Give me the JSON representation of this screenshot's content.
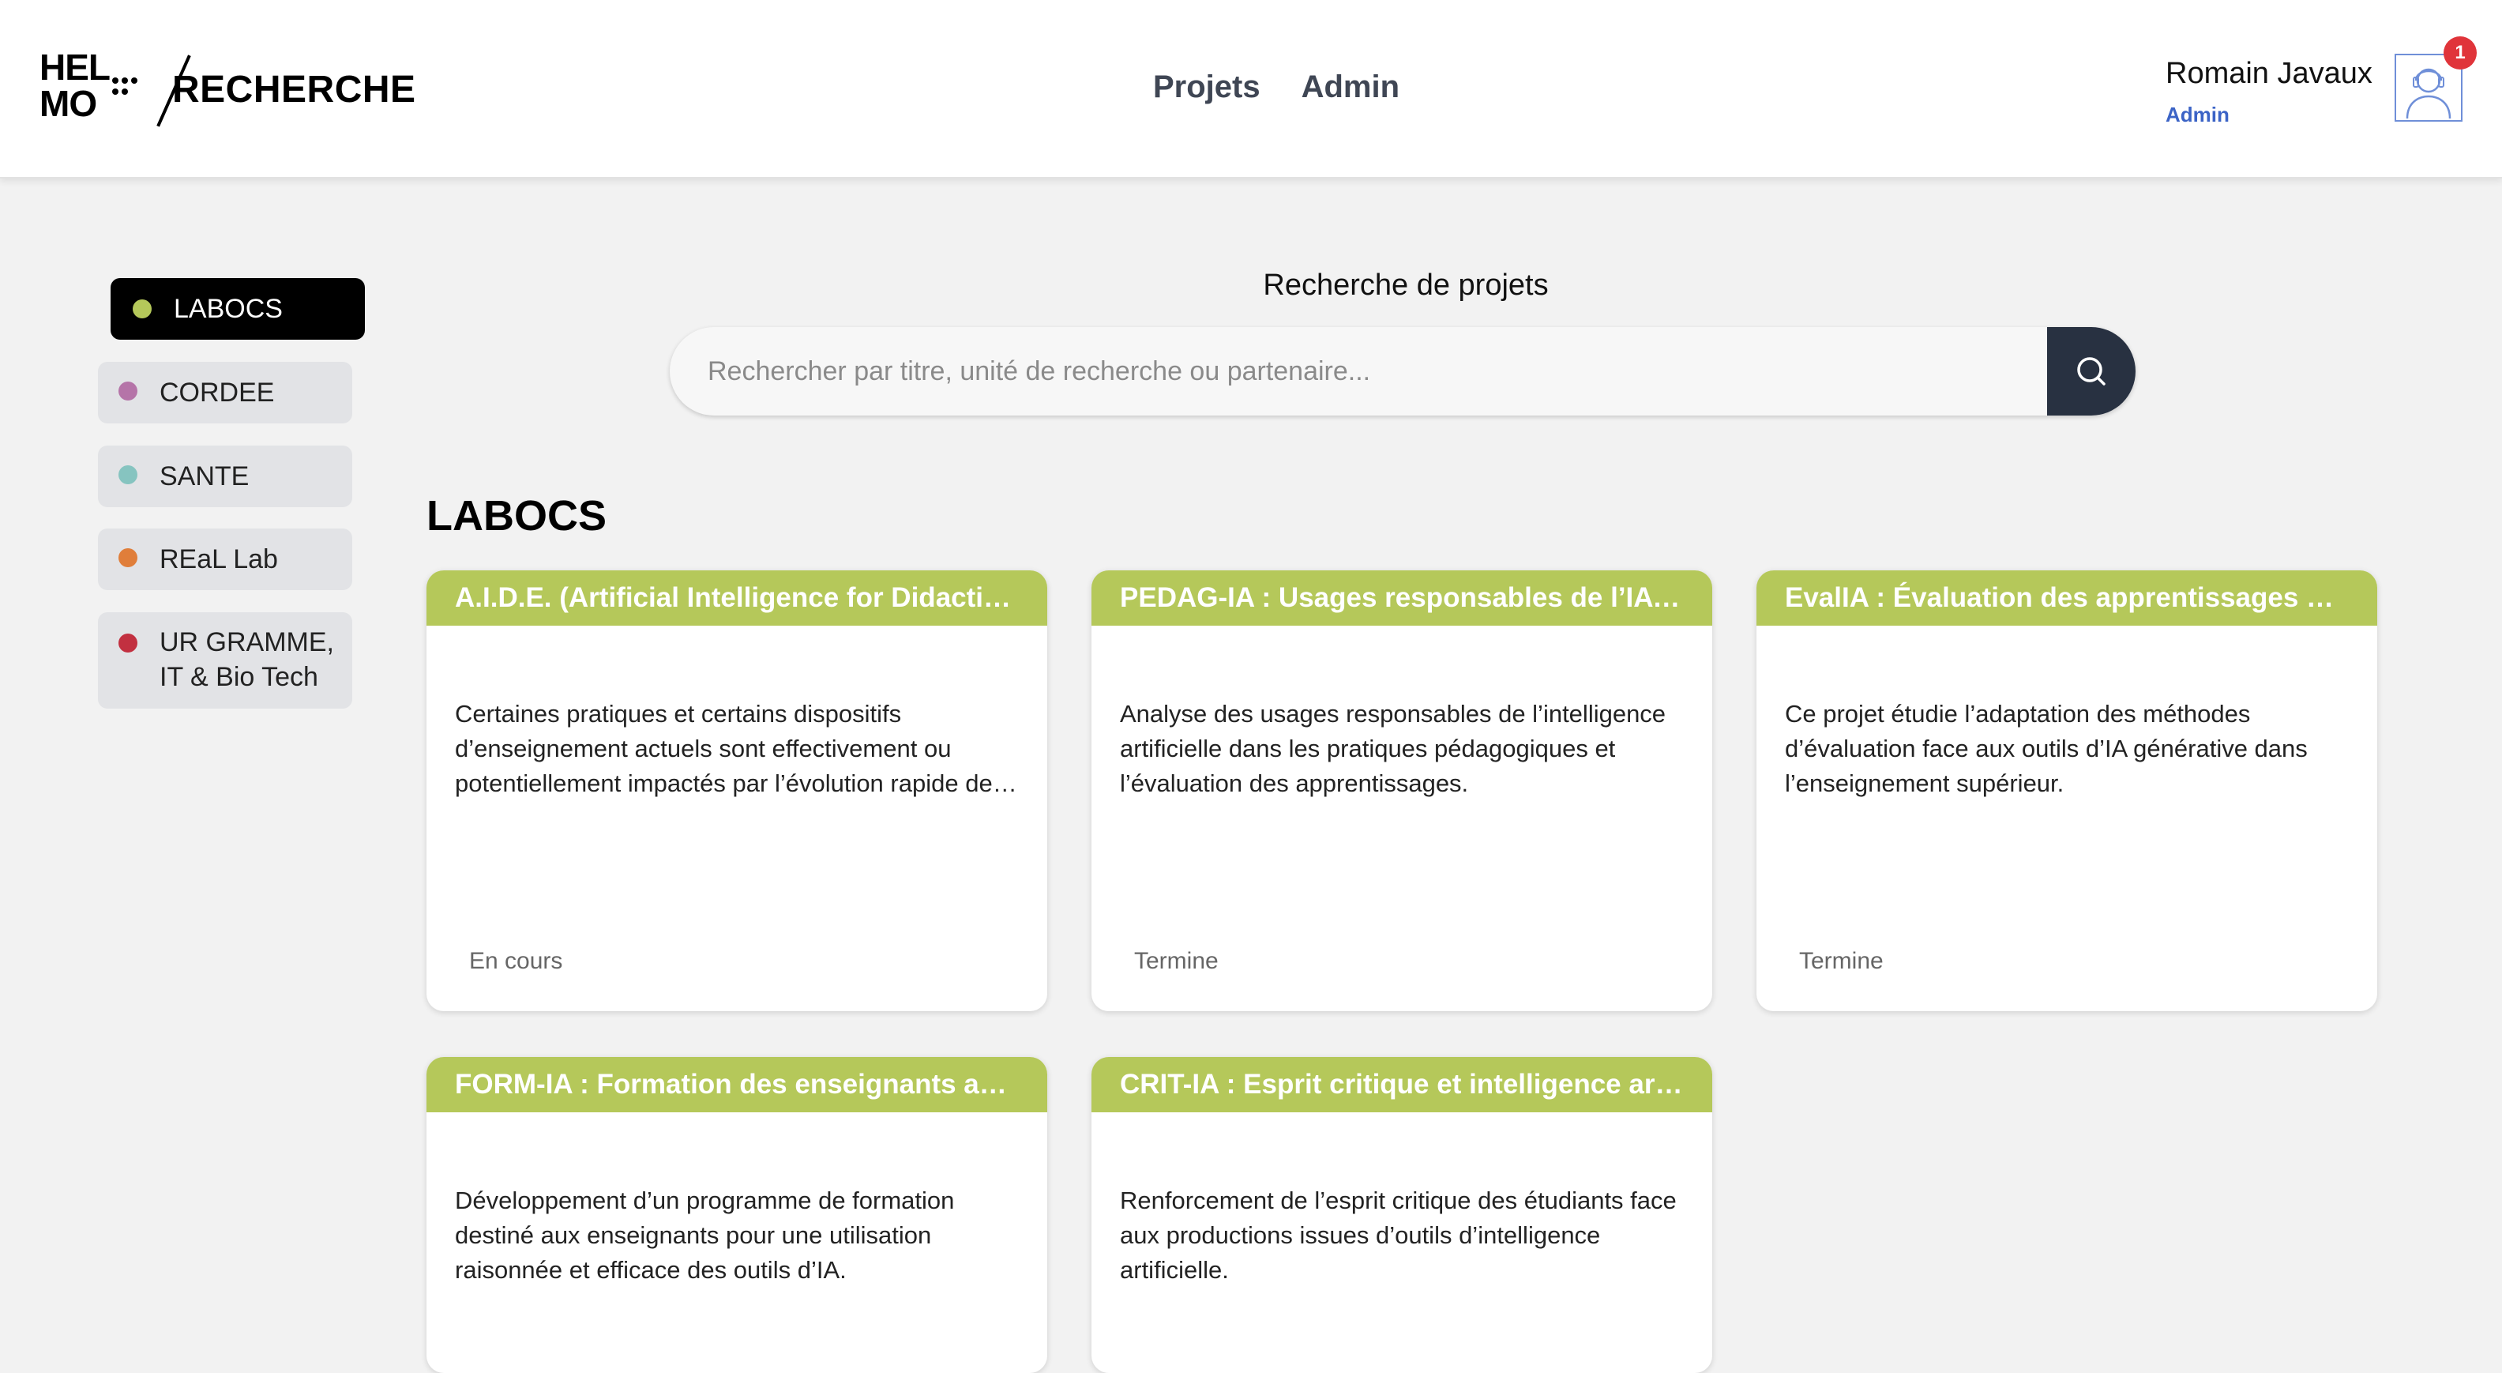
{
  "header": {
    "logo_hel": "HEL",
    "logo_mo": "MO",
    "logo_text": "RECHERCHE",
    "nav": [
      "Projets",
      "Admin"
    ],
    "user_name": "Romain Javaux",
    "user_role": "Admin",
    "notification_count": "1"
  },
  "sidebar": {
    "items": [
      {
        "label": "LABOCS",
        "color": "#b5c85a",
        "active": true
      },
      {
        "label": "CORDEE",
        "color": "#b574a8",
        "active": false
      },
      {
        "label": "SANTE",
        "color": "#86c4c0",
        "active": false
      },
      {
        "label": "REaL Lab",
        "color": "#e07e3a",
        "active": false
      },
      {
        "label_line1": "UR GRAMME,",
        "label_line2": "IT & Bio Tech",
        "color": "#c23040",
        "active": false
      }
    ]
  },
  "search": {
    "title": "Recherche de projets",
    "placeholder": "Rechercher par titre, unité de recherche ou partenaire..."
  },
  "section": {
    "title": "LABOCS",
    "accent": "#b5c85a"
  },
  "cards": [
    {
      "title": "A.I.D.E. (Artificial Intelligence for Didactics and Education)",
      "description": "Certaines pratiques et certains dispositifs d’enseignement actuels sont effectivement ou potentiellement impactés par l’évolution rapide de l’intelligence artificielle.",
      "status": "En cours"
    },
    {
      "title": "PEDAG-IA : Usages responsables de l’IA en pédagogie",
      "description": "Analyse des usages responsables de l’intelligence artificielle dans les pratiques pédagogiques et l’évaluation des apprentissages.",
      "status": "Termine"
    },
    {
      "title": "EvalIA : Évaluation des apprentissages à l’ère de l’IA",
      "description": "Ce projet étudie l’adaptation des méthodes d’évaluation face aux outils d’IA générative dans l’enseignement supérieur.",
      "status": "Termine"
    },
    {
      "title": "FORM-IA : Formation des enseignants aux outils d’IA",
      "description": "Développement d’un programme de formation destiné aux enseignants pour une utilisation raisonnée et efficace des outils d’IA.",
      "status": ""
    },
    {
      "title": "CRIT-IA : Esprit critique et intelligence artificielle",
      "description": "Renforcement de l’esprit critique des étudiants face aux productions issues d’outils d’intelligence artificielle.",
      "status": ""
    }
  ]
}
